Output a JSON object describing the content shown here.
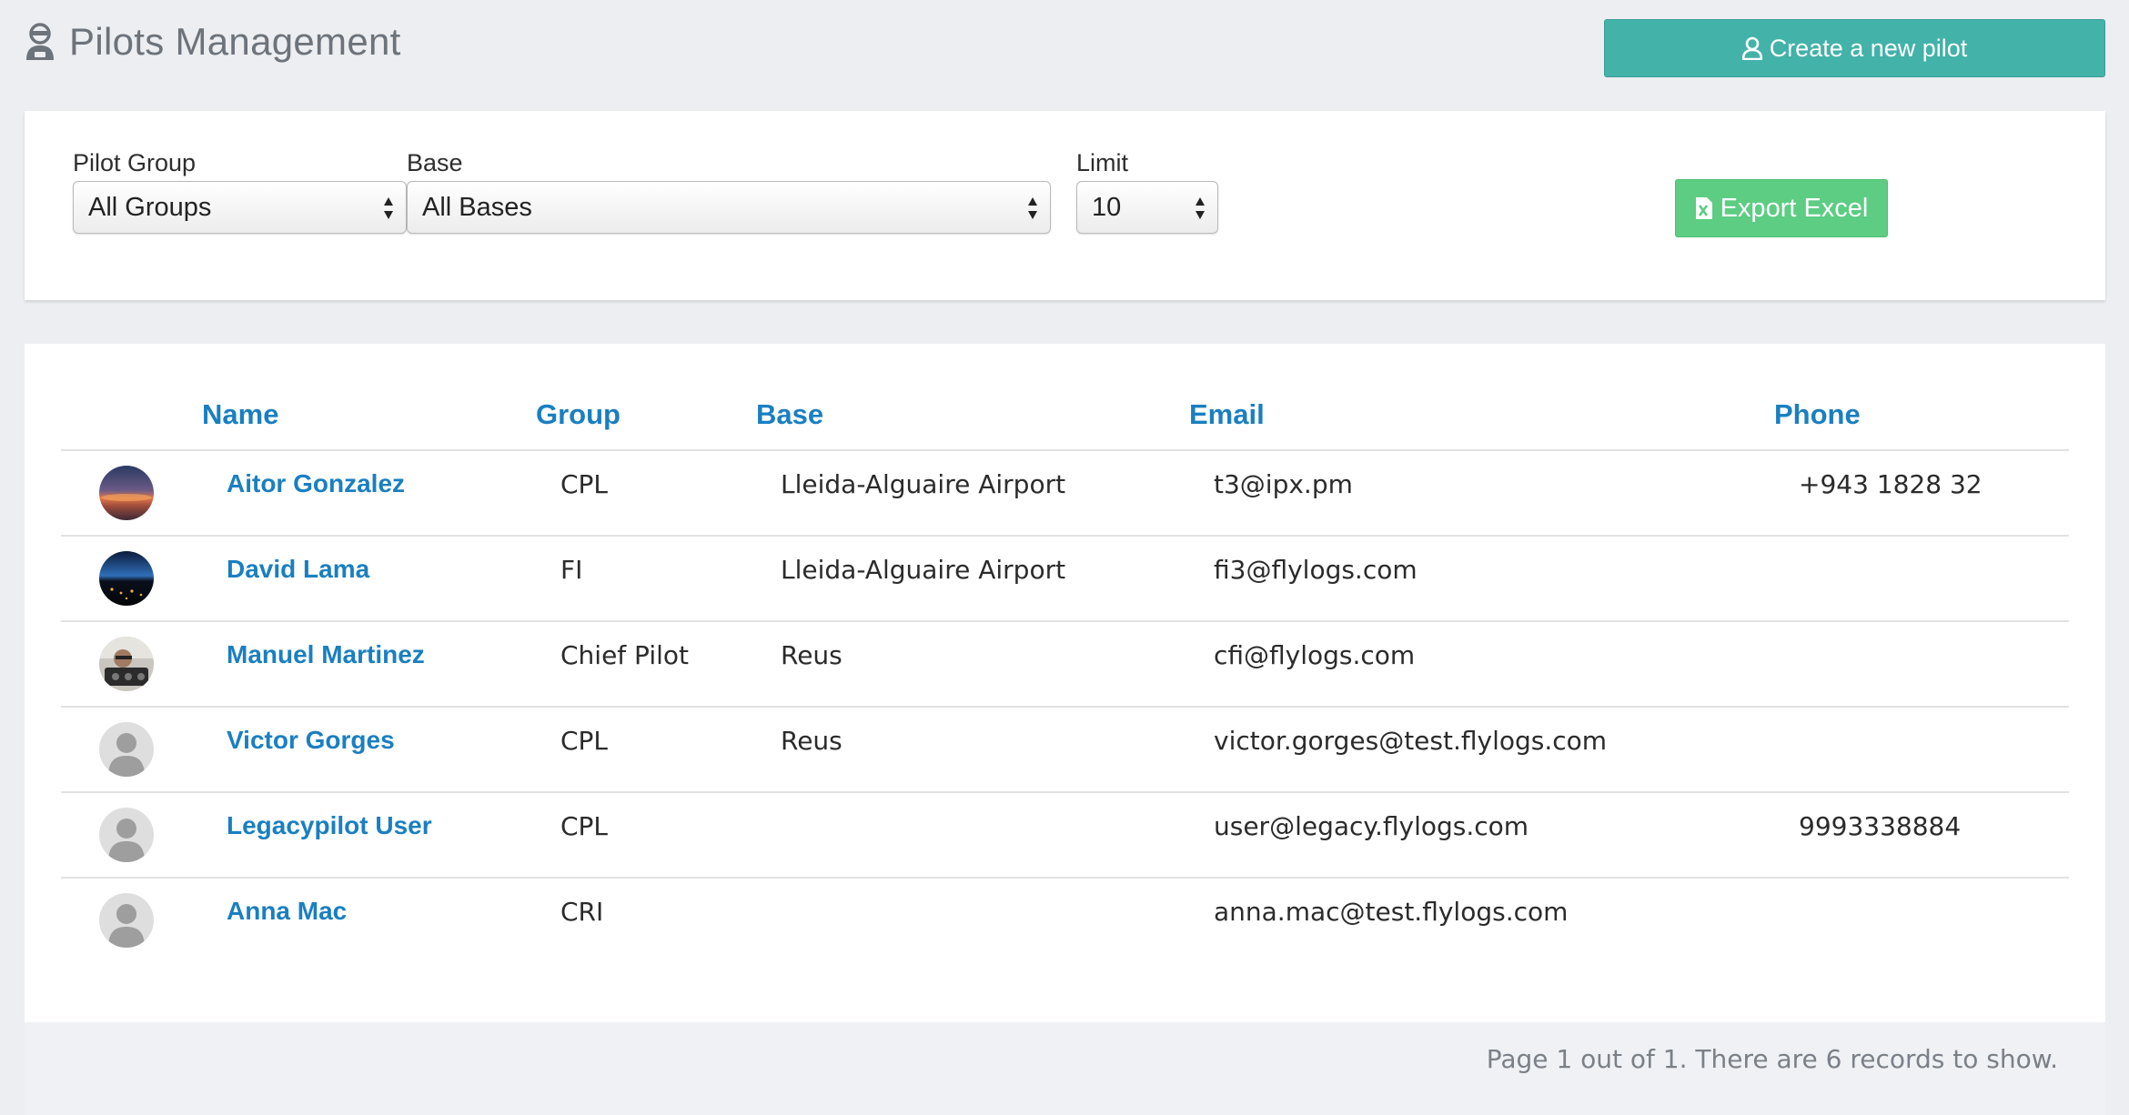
{
  "header": {
    "title": "Pilots Management",
    "title_icon": "pilot-icon",
    "create_label": "Create a new pilot",
    "create_icon": "user-icon"
  },
  "filters": {
    "group_label": "Pilot Group",
    "group_value": "All Groups",
    "base_label": "Base",
    "base_value": "All Bases",
    "limit_label": "Limit",
    "limit_value": "10",
    "export_label": "Export Excel",
    "export_icon": "excel-file-icon"
  },
  "table": {
    "columns": [
      "Name",
      "Group",
      "Base",
      "Email",
      "Phone"
    ],
    "rows": [
      {
        "name": "Aitor Gonzalez",
        "group": "CPL",
        "base": "Lleida-Alguaire Airport",
        "email": "t3@ipx.pm",
        "phone": "+943 1828 32",
        "avatar": "sunset"
      },
      {
        "name": "David Lama",
        "group": "FI",
        "base": "Lleida-Alguaire Airport",
        "email": "fi3@flylogs.com",
        "phone": "",
        "avatar": "night"
      },
      {
        "name": "Manuel Martinez",
        "group": "Chief Pilot",
        "base": "Reus",
        "email": "cfi@flylogs.com",
        "phone": "",
        "avatar": "cockpit"
      },
      {
        "name": "Victor Gorges",
        "group": "CPL",
        "base": "Reus",
        "email": "victor.gorges@test.flylogs.com",
        "phone": "",
        "avatar": "default"
      },
      {
        "name": "Legacypilot User",
        "group": "CPL",
        "base": "",
        "email": "user@legacy.flylogs.com",
        "phone": "9993338884",
        "avatar": "default"
      },
      {
        "name": "Anna Mac",
        "group": "CRI",
        "base": "",
        "email": "anna.mac@test.flylogs.com",
        "phone": "",
        "avatar": "default"
      }
    ]
  },
  "footer": {
    "text": "Page 1 out of 1. There are 6 records to show."
  },
  "colors": {
    "accent_blue": "#1a7fc1",
    "create_button": "#43b2a9",
    "export_button": "#5ccd82"
  }
}
